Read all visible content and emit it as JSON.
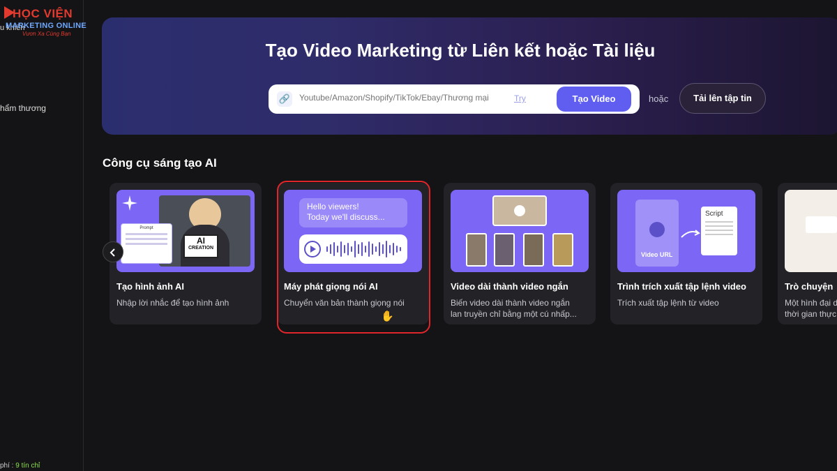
{
  "logo": {
    "brand": "HỌC VIỆN",
    "sub": "MARKETING ONLINE",
    "tagline": "Vươn Xa Cùng Bạn",
    "clipped_label": "u khiển"
  },
  "sidebar": {
    "item_clipped": "hẩm thương",
    "credit_prefix": "phí :",
    "credit_value": "9 tín chỉ"
  },
  "hero": {
    "title": "Tạo Video Marketing từ Liên kết hoặc Tài liệu",
    "search_placeholder": "Youtube/Amazon/Shopify/TikTok/Ebay/Thương mại",
    "try_label": "Try",
    "create_button": "Tạo Video",
    "or_label": "hoặc",
    "upload_button": "Tải lên tập tin"
  },
  "section": {
    "title": "Công cụ sáng tạo AI"
  },
  "cards": [
    {
      "title": "Tạo hình ảnh AI",
      "desc": "Nhập lời nhắc để tạo hình ảnh",
      "desc2": "",
      "thumb_text": "AI",
      "thumb_text2": "CREATION",
      "thumb_label": "Prompt"
    },
    {
      "title": "Máy phát giọng nói AI",
      "desc": "Chuyển văn bản thành giọng nói",
      "desc2": "",
      "bubble1": "Hello viewers!",
      "bubble2": "Today we'll discuss..."
    },
    {
      "title": "Video dài thành video ngắn",
      "desc": "Biến video dài thành video ngắn",
      "desc2": "lan truyền chỉ bằng một cú nhấp..."
    },
    {
      "title": "Trình trích xuất tập lệnh video",
      "desc": "Trích xuất tập lệnh từ video",
      "desc2": "",
      "thumb_label": "Video URL",
      "thumb_label2": "Script"
    },
    {
      "title": "Trò chuyện",
      "desc": "Một hình đại d",
      "desc2": "thời gian thực"
    }
  ],
  "colors": {
    "accent": "#5f5ef0",
    "card_thumb": "#7b66f5",
    "highlight": "#e0262b"
  }
}
